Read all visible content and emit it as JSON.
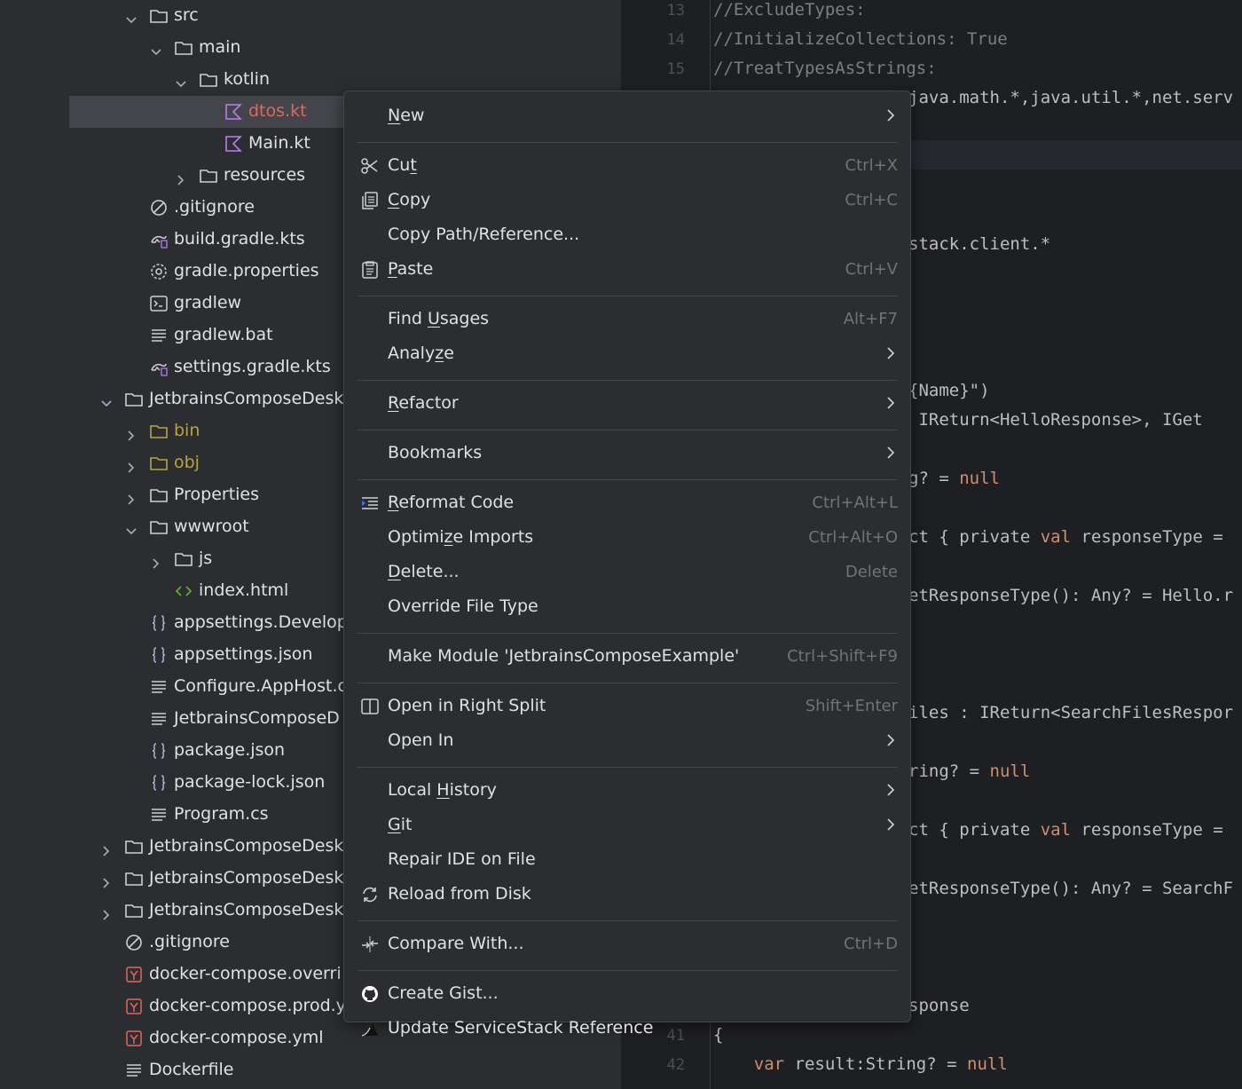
{
  "tree": [
    {
      "label": "src",
      "type": "folder",
      "expanded": true,
      "depth": 3
    },
    {
      "label": "main",
      "type": "folder",
      "expanded": true,
      "depth": 4
    },
    {
      "label": "kotlin",
      "type": "folder",
      "expanded": true,
      "depth": 5
    },
    {
      "label": "dtos.kt",
      "type": "kotlin",
      "depth": 6,
      "selected": true,
      "color": "#e0695e"
    },
    {
      "label": "Main.kt",
      "type": "kotlin",
      "depth": 6
    },
    {
      "label": "resources",
      "type": "folder",
      "expanded": false,
      "depth": 5
    },
    {
      "label": ".gitignore",
      "type": "ignore",
      "depth": 3
    },
    {
      "label": "build.gradle.kts",
      "type": "gradle",
      "depth": 3
    },
    {
      "label": "gradle.properties",
      "type": "gear",
      "depth": 3
    },
    {
      "label": "gradlew",
      "type": "terminal",
      "depth": 3
    },
    {
      "label": "gradlew.bat",
      "type": "text",
      "depth": 3
    },
    {
      "label": "settings.gradle.kts",
      "type": "gradle",
      "depth": 3
    },
    {
      "label": "JetbrainsComposeDesk",
      "type": "folder",
      "expanded": true,
      "depth": 2
    },
    {
      "label": "bin",
      "type": "folder",
      "expanded": false,
      "depth": 3,
      "color": "#b5a63b"
    },
    {
      "label": "obj",
      "type": "folder",
      "expanded": false,
      "depth": 3,
      "color": "#b5a63b"
    },
    {
      "label": "Properties",
      "type": "folder",
      "expanded": false,
      "depth": 3
    },
    {
      "label": "wwwroot",
      "type": "folder",
      "expanded": true,
      "depth": 3
    },
    {
      "label": "js",
      "type": "folder",
      "expanded": false,
      "depth": 4
    },
    {
      "label": "index.html",
      "type": "html",
      "depth": 4
    },
    {
      "label": "appsettings.Develop",
      "type": "json",
      "depth": 3
    },
    {
      "label": "appsettings.json",
      "type": "json",
      "depth": 3
    },
    {
      "label": "Configure.AppHost.c",
      "type": "text",
      "depth": 3
    },
    {
      "label": "JetbrainsComposeD",
      "type": "text",
      "depth": 3
    },
    {
      "label": "package.json",
      "type": "json",
      "depth": 3
    },
    {
      "label": "package-lock.json",
      "type": "json",
      "depth": 3
    },
    {
      "label": "Program.cs",
      "type": "text",
      "depth": 3
    },
    {
      "label": "JetbrainsComposeDesk",
      "type": "folder",
      "expanded": false,
      "depth": 2
    },
    {
      "label": "JetbrainsComposeDesk",
      "type": "folder",
      "expanded": false,
      "depth": 2
    },
    {
      "label": "JetbrainsComposeDesk",
      "type": "folder",
      "expanded": false,
      "depth": 2
    },
    {
      "label": ".gitignore",
      "type": "ignore",
      "depth": 2
    },
    {
      "label": "docker-compose.overri",
      "type": "yaml",
      "depth": 2
    },
    {
      "label": "docker-compose.prod.y",
      "type": "yaml",
      "depth": 2
    },
    {
      "label": "docker-compose.yml",
      "type": "yaml",
      "depth": 2
    },
    {
      "label": "Dockerfile",
      "type": "text",
      "depth": 2
    }
  ],
  "editor": {
    "lines": [
      {
        "n": "13",
        "text": "//ExcludeTypes:",
        "cls": "cm"
      },
      {
        "n": "14",
        "text": "//InitializeCollections: True",
        "cls": "cm"
      },
      {
        "n": "15",
        "text": "//TreatTypesAsStrings:",
        "cls": "cm"
      },
      {
        "n": "",
        "text": "java.math.*,java.util.*,net.serv",
        "cls": ""
      },
      {
        "n": "",
        "text": "stack.client.*",
        "cls": ""
      },
      {
        "n": "",
        "text": "{Name}\")",
        "cls": ""
      },
      {
        "n": "",
        "text": " IReturn<HelloResponse>, IGet",
        "cls": ""
      },
      {
        "n": "",
        "text": "g? = ",
        "cls": "",
        "kw": "null"
      },
      {
        "n": "",
        "text": "ct { private ",
        "cls": "",
        "kw": "val",
        "rest": " responseType ="
      },
      {
        "n": "",
        "text": "etResponseType(): Any? = Hello.r",
        "cls": ""
      },
      {
        "n": "",
        "text": "iles : IReturn<SearchFilesRespor",
        "cls": ""
      },
      {
        "n": "",
        "text": "ring? = ",
        "cls": "",
        "kw": "null"
      },
      {
        "n": "",
        "text": "ct { private ",
        "cls": "",
        "kw": "val",
        "rest": " responseType ="
      },
      {
        "n": "",
        "text": "etResponseType(): Any? = SearchF",
        "cls": ""
      },
      {
        "n": "",
        "text": "sponse",
        "cls": ""
      },
      {
        "n": "41",
        "text": "{",
        "cls": ""
      },
      {
        "n": "42",
        "text": "    ",
        "cls": "",
        "kw": "var",
        "rest": " result:String? = ",
        "kw2": "null"
      }
    ]
  },
  "menu": {
    "items": [
      {
        "label": "New",
        "u": "N",
        "submenu": true
      },
      {
        "sep": true
      },
      {
        "label": "Cut",
        "u": "t",
        "shortcut": "Ctrl+X",
        "icon": "scissors-icon"
      },
      {
        "label": "Copy",
        "u": "C",
        "shortcut": "Ctrl+C",
        "icon": "copy-icon"
      },
      {
        "label": "Copy Path/Reference..."
      },
      {
        "label": "Paste",
        "u": "P",
        "shortcut": "Ctrl+V",
        "icon": "paste-icon"
      },
      {
        "sep": true
      },
      {
        "label": "Find Usages",
        "u": "U",
        "shortcut": "Alt+F7"
      },
      {
        "label": "Analyze",
        "u": "z",
        "submenu": true
      },
      {
        "sep": true
      },
      {
        "label": "Refactor",
        "u": "R",
        "submenu": true
      },
      {
        "sep": true
      },
      {
        "label": "Bookmarks",
        "submenu": true
      },
      {
        "sep": true
      },
      {
        "label": "Reformat Code",
        "u": "R",
        "shortcut": "Ctrl+Alt+L",
        "icon": "reformat-icon"
      },
      {
        "label": "Optimize Imports",
        "u": "z",
        "shortcut": "Ctrl+Alt+O"
      },
      {
        "label": "Delete...",
        "u": "D",
        "shortcut": "Delete"
      },
      {
        "label": "Override File Type"
      },
      {
        "sep": true
      },
      {
        "label": "Make Module 'JetbrainsComposeExample'",
        "shortcut": "Ctrl+Shift+F9"
      },
      {
        "sep": true
      },
      {
        "label": "Open in Right Split",
        "shortcut": "Shift+Enter",
        "icon": "split-icon"
      },
      {
        "label": "Open In",
        "submenu": true
      },
      {
        "sep": true
      },
      {
        "label": "Local History",
        "u": "H",
        "submenu": true
      },
      {
        "label": "Git",
        "u": "G",
        "submenu": true
      },
      {
        "label": "Repair IDE on File"
      },
      {
        "label": "Reload from Disk",
        "icon": "reload-icon"
      },
      {
        "sep": true
      },
      {
        "label": "Compare With...",
        "shortcut": "Ctrl+D",
        "icon": "compare-icon"
      },
      {
        "sep": true
      },
      {
        "label": "Create Gist...",
        "icon": "github-icon"
      },
      {
        "label": "Update ServiceStack Reference",
        "icon": "servicestack-icon"
      }
    ]
  },
  "colors": {
    "accent": "#3574f0",
    "selection": "#43454a",
    "menuBg": "#2b2d30",
    "editorBg": "#1e1f22"
  }
}
